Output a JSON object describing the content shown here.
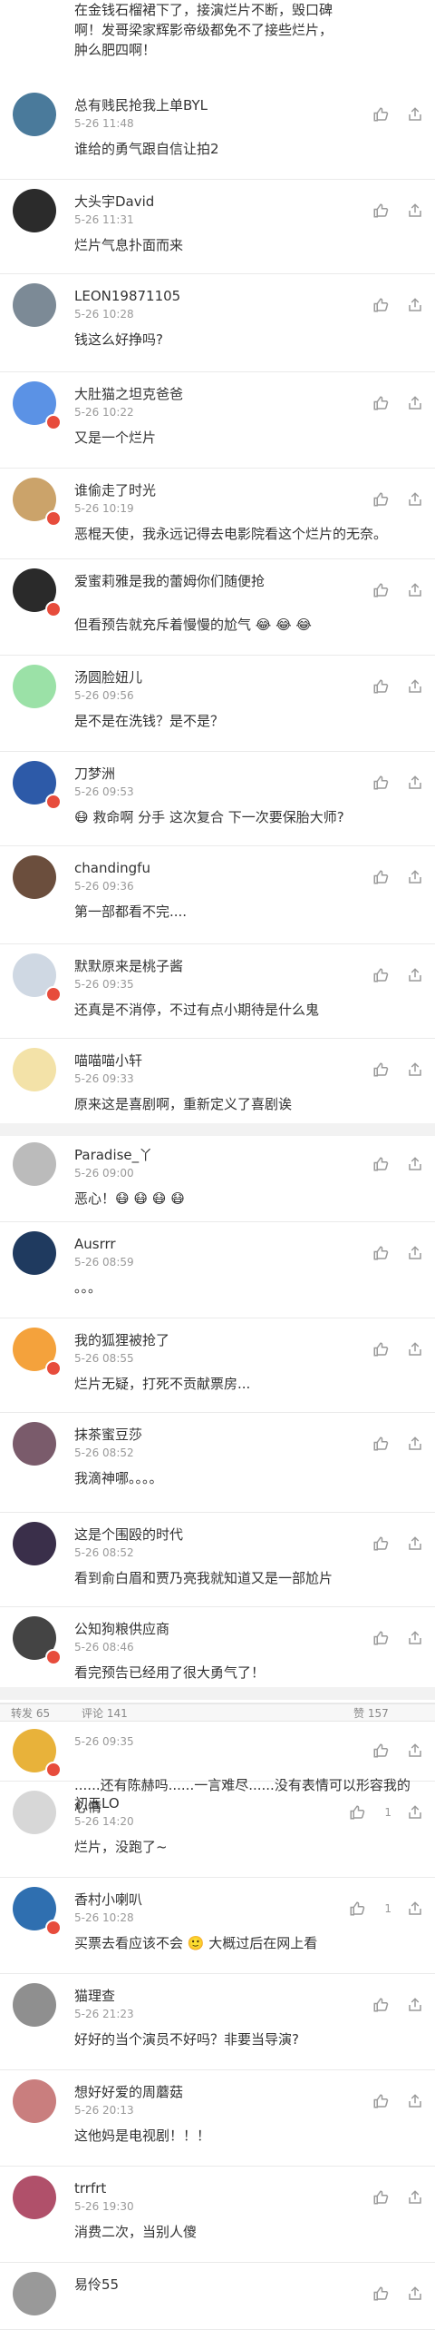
{
  "intro": {
    "lines": [
      "在金钱石榴裙下了，接演烂片不断，毁口碑",
      "啊！发哥梁家辉影帝级都免不了接些烂片，",
      "肿么肥四啊！"
    ]
  },
  "tabs": {
    "left": "转发 65",
    "mid": "评论 141",
    "right": "赞 157"
  },
  "comments": [
    {
      "user": "总有贱民抢我上单BYL",
      "time": "5-26 11:48",
      "text": "谁给的勇气跟自信让拍2",
      "avatar": "#4a7a9b"
    },
    {
      "user": "大头宇David",
      "time": "5-26 11:31",
      "text": "烂片气息扑面而来",
      "avatar": "#2b2b2b"
    },
    {
      "user": "LEON19871105",
      "time": "5-26 10:28",
      "text": "钱这么好挣吗?",
      "avatar": "#7c8a96"
    },
    {
      "user": "大肚猫之坦克爸爸",
      "time": "5-26 10:22",
      "text": "又是一个烂片",
      "avatar": "#5b92e5",
      "vip": true
    },
    {
      "user": "谁偷走了时光",
      "time": "5-26 10:19",
      "text": "恶棍天使，我永远记得去电影院看这个烂片的无奈。",
      "avatar": "#cba36a",
      "vip": true
    },
    {
      "user": "爱蜜莉雅是我的蕾姆你们随便抢",
      "time": "",
      "text": "但看预告就充斥着慢慢的尬气 😂 😂 😂",
      "avatar": "#2a2a2a",
      "vip": true
    },
    {
      "user": "汤圆脸妞儿",
      "time": "5-26 09:56",
      "text": "是不是在洗钱？是不是？",
      "avatar": "#9be1a7"
    },
    {
      "user": "刀梦洲",
      "time": "5-26 09:53",
      "text": "😷 救命啊 分手 这次复合 下一次要保胎大师?",
      "avatar": "#2d5aa8",
      "vip": true
    },
    {
      "user": "chandingfu",
      "time": "5-26 09:36",
      "text": "第一部都看不完....",
      "avatar": "#6b4e3d"
    },
    {
      "user": "默默原来是桃子酱",
      "time": "5-26 09:35",
      "text": "还真是不消停，不过有点小期待是什么鬼",
      "avatar": "#cfd8e3",
      "vip": true
    },
    {
      "user": "喵喵喵小轩",
      "time": "5-26 09:33",
      "text": "原来这是喜剧啊，重新定义了喜剧诶",
      "avatar": "#f3e2a8"
    },
    {
      "user": "Paradise_丫",
      "time": "5-26 09:00",
      "text": "恶心！😷 😷 😷 😷",
      "avatar": "#bbbbbb"
    },
    {
      "user": "Ausrrr",
      "time": "5-26 08:59",
      "text": "。。。",
      "avatar": "#1f3a5f"
    },
    {
      "user": "我的狐狸被抢了",
      "time": "5-26 08:55",
      "text": "烂片无疑，打死不贡献票房...",
      "avatar": "#f4a23c",
      "vip": true
    },
    {
      "user": "抹茶蜜豆莎",
      "time": "5-26 08:52",
      "text": "我滴神哪。。。。",
      "avatar": "#7a5b6b"
    },
    {
      "user": "这是个围殴的时代",
      "time": "5-26 08:52",
      "text": "看到俞白眉和贾乃亮我就知道又是一部尬片",
      "avatar": "#3a2f4a"
    },
    {
      "user": "公知狗粮供应商",
      "time": "5-26 08:46",
      "text": "看完预告已经用了很大勇气了！",
      "avatar": "#444444",
      "vip": true
    },
    {
      "user": "",
      "time": "5-26 09:35",
      "text": "......还有陈赫吗......一言难尽......没有表情可以形容我的心情",
      "avatar": "#e8b23a",
      "vip": true
    },
    {
      "user": "初五LO",
      "time": "5-26 14:20",
      "text": "烂片，没跑了~",
      "avatar": "#d7d7d7",
      "likes": "1"
    },
    {
      "user": "香村小喇叭",
      "time": "5-26 10:28",
      "text": "买票去看应该不会 🙂 大概过后在网上看",
      "avatar": "#2f6fb0",
      "vip": true,
      "likes": "1"
    },
    {
      "user": "猫理查",
      "time": "5-26 21:23",
      "text": "好好的当个演员不好吗？非要当导演?",
      "avatar": "#8f8f8f"
    },
    {
      "user": "想好好爱的周蘑菇",
      "time": "5-26 20:13",
      "text": "这他妈是电视剧！！！",
      "avatar": "#c97e7e"
    },
    {
      "user": "trrfrt",
      "time": "5-26 19:30",
      "text": "消费二次，当别人傻",
      "avatar": "#b0506a"
    },
    {
      "user": "易伶55",
      "time": "",
      "text": "",
      "avatar": "#999999"
    }
  ]
}
